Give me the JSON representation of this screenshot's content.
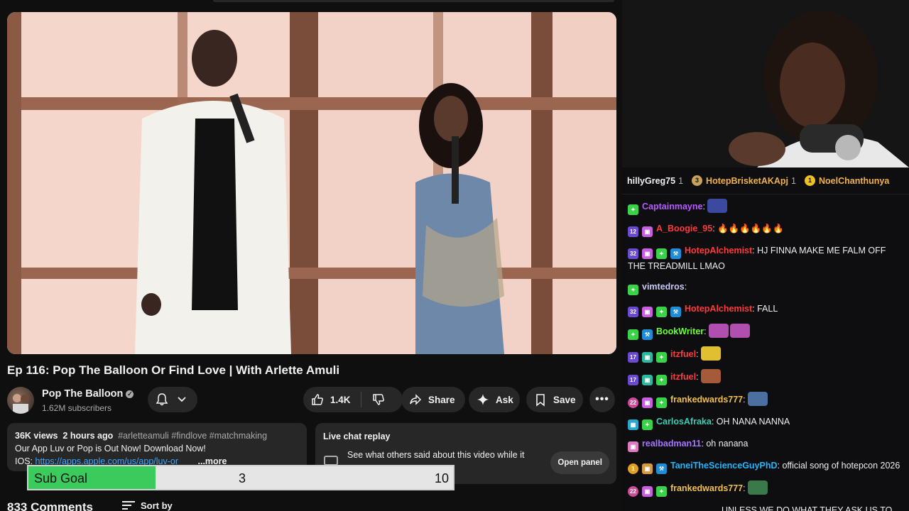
{
  "video": {
    "title": "Ep 116: Pop The Balloon Or Find Love | With Arlette Amuli"
  },
  "channel": {
    "name": "Pop The Balloon",
    "subscribers": "1.62M subscribers"
  },
  "actions": {
    "likes": "1.4K",
    "share": "Share",
    "ask": "Ask",
    "save": "Save"
  },
  "description": {
    "views": "36K views",
    "age": "2 hours ago",
    "tags": "#arletteamuli #findlove #matchmaking",
    "line1": "Our App Luv or Pop is Out Now! Download Now!",
    "ios_label": "IOS:",
    "ios_link": "https://apps.apple.com/us/app/luv-or",
    "more": "...more"
  },
  "livechat": {
    "title": "Live chat replay",
    "text": "See what others said about this video while it",
    "button": "Open panel"
  },
  "comments": {
    "count": "833 Comments",
    "sort": "Sort by"
  },
  "subgoal": {
    "label": "Sub Goal",
    "current": "3",
    "target": "10",
    "progress": 0.3
  },
  "chat": {
    "gifts": [
      {
        "name": "hillyGreg75",
        "count": "1",
        "coin": "",
        "color": "#efeff1"
      },
      {
        "name": "HotepBrisketAKApj",
        "count": "1",
        "coin": "3",
        "color": "#f0b14a"
      },
      {
        "name": "NoelChanthunya",
        "count": "",
        "coin": "1",
        "color": "#f0b14a"
      }
    ],
    "messages": [
      {
        "badges": [
          "gem"
        ],
        "user": "Captainmayne",
        "color": "#b65cff",
        "text": "",
        "emotes": [
          "#3b4a9e"
        ]
      },
      {
        "badges": [
          "12",
          "gift"
        ],
        "user": "A_Boogie_95",
        "color": "#ff3a3a",
        "text": "🔥🔥🔥🔥🔥🔥",
        "emotes": []
      },
      {
        "badges": [
          "32",
          "gift",
          "gem",
          "hammer"
        ],
        "user": "HotepAlchemist",
        "color": "#ff3a3a",
        "text": "HJ FINNA MAKE ME FALM OFF THE TREADMILL LMAO",
        "emotes": []
      },
      {
        "badges": [
          "gem"
        ],
        "user": "vimtedros",
        "color": "#c9c9f5",
        "text": "",
        "emotes": []
      },
      {
        "badges": [
          "32",
          "gift",
          "gem",
          "hammer"
        ],
        "user": "HotepAlchemist",
        "color": "#ff3a3a",
        "text": "FALL",
        "emotes": []
      },
      {
        "badges": [
          "gem",
          "hammer"
        ],
        "user": "BookWriter",
        "color": "#6bff3a",
        "text": "",
        "emotes": [
          "#b14fb0",
          "#b14fb0"
        ]
      },
      {
        "badges": [
          "17",
          "gift2",
          "gem"
        ],
        "user": "itzfuel",
        "color": "#ff3a3a",
        "text": "",
        "emotes": [
          "#e0c030"
        ]
      },
      {
        "badges": [
          "17",
          "gift2",
          "gem"
        ],
        "user": "itzfuel",
        "color": "#ff3a3a",
        "text": "",
        "emotes": [
          "#a55a3a"
        ]
      },
      {
        "badges": [
          "22",
          "gift",
          "gem"
        ],
        "user": "frankedwards777",
        "color": "#f0c04a",
        "text": "",
        "emotes": [
          "#4a6fa0"
        ]
      },
      {
        "badges": [
          "grid",
          "gem"
        ],
        "user": "CarlosAfraka",
        "color": "#3acbb5",
        "text": "OH NANA NANNA",
        "emotes": []
      },
      {
        "badges": [
          "gift3"
        ],
        "user": "realbadman11",
        "color": "#a875ff",
        "text": "oh nanana",
        "emotes": []
      },
      {
        "badges": [
          "1",
          "gift4",
          "hammer"
        ],
        "user": "TaneiTheScienceGuyPhD",
        "color": "#1fb8ff",
        "text": "official song of hotepcon 2026",
        "emotes": []
      },
      {
        "badges": [
          "22",
          "gift",
          "gem"
        ],
        "user": "frankedwards777",
        "color": "#f0c04a",
        "text": "",
        "emotes": [
          "#3a7a4a"
        ]
      }
    ],
    "last_partial": "UNLESS WE DO WHAT THEY ASK US TO"
  }
}
